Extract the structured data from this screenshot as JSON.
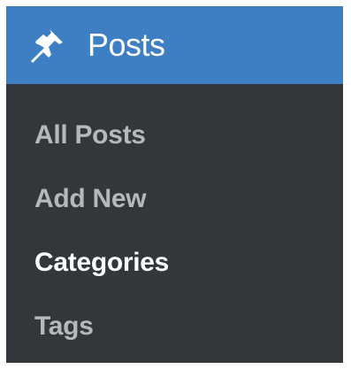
{
  "menu": {
    "header": {
      "label": "Posts",
      "icon": "pushpin-icon",
      "background": "#3e7ec2"
    },
    "background": "#32373c",
    "items": [
      {
        "label": "All Posts",
        "current": false
      },
      {
        "label": "Add New",
        "current": false
      },
      {
        "label": "Categories",
        "current": true
      },
      {
        "label": "Tags",
        "current": false
      }
    ],
    "colors": {
      "item_text": "#b4b9be",
      "current_text": "#ffffff"
    }
  }
}
